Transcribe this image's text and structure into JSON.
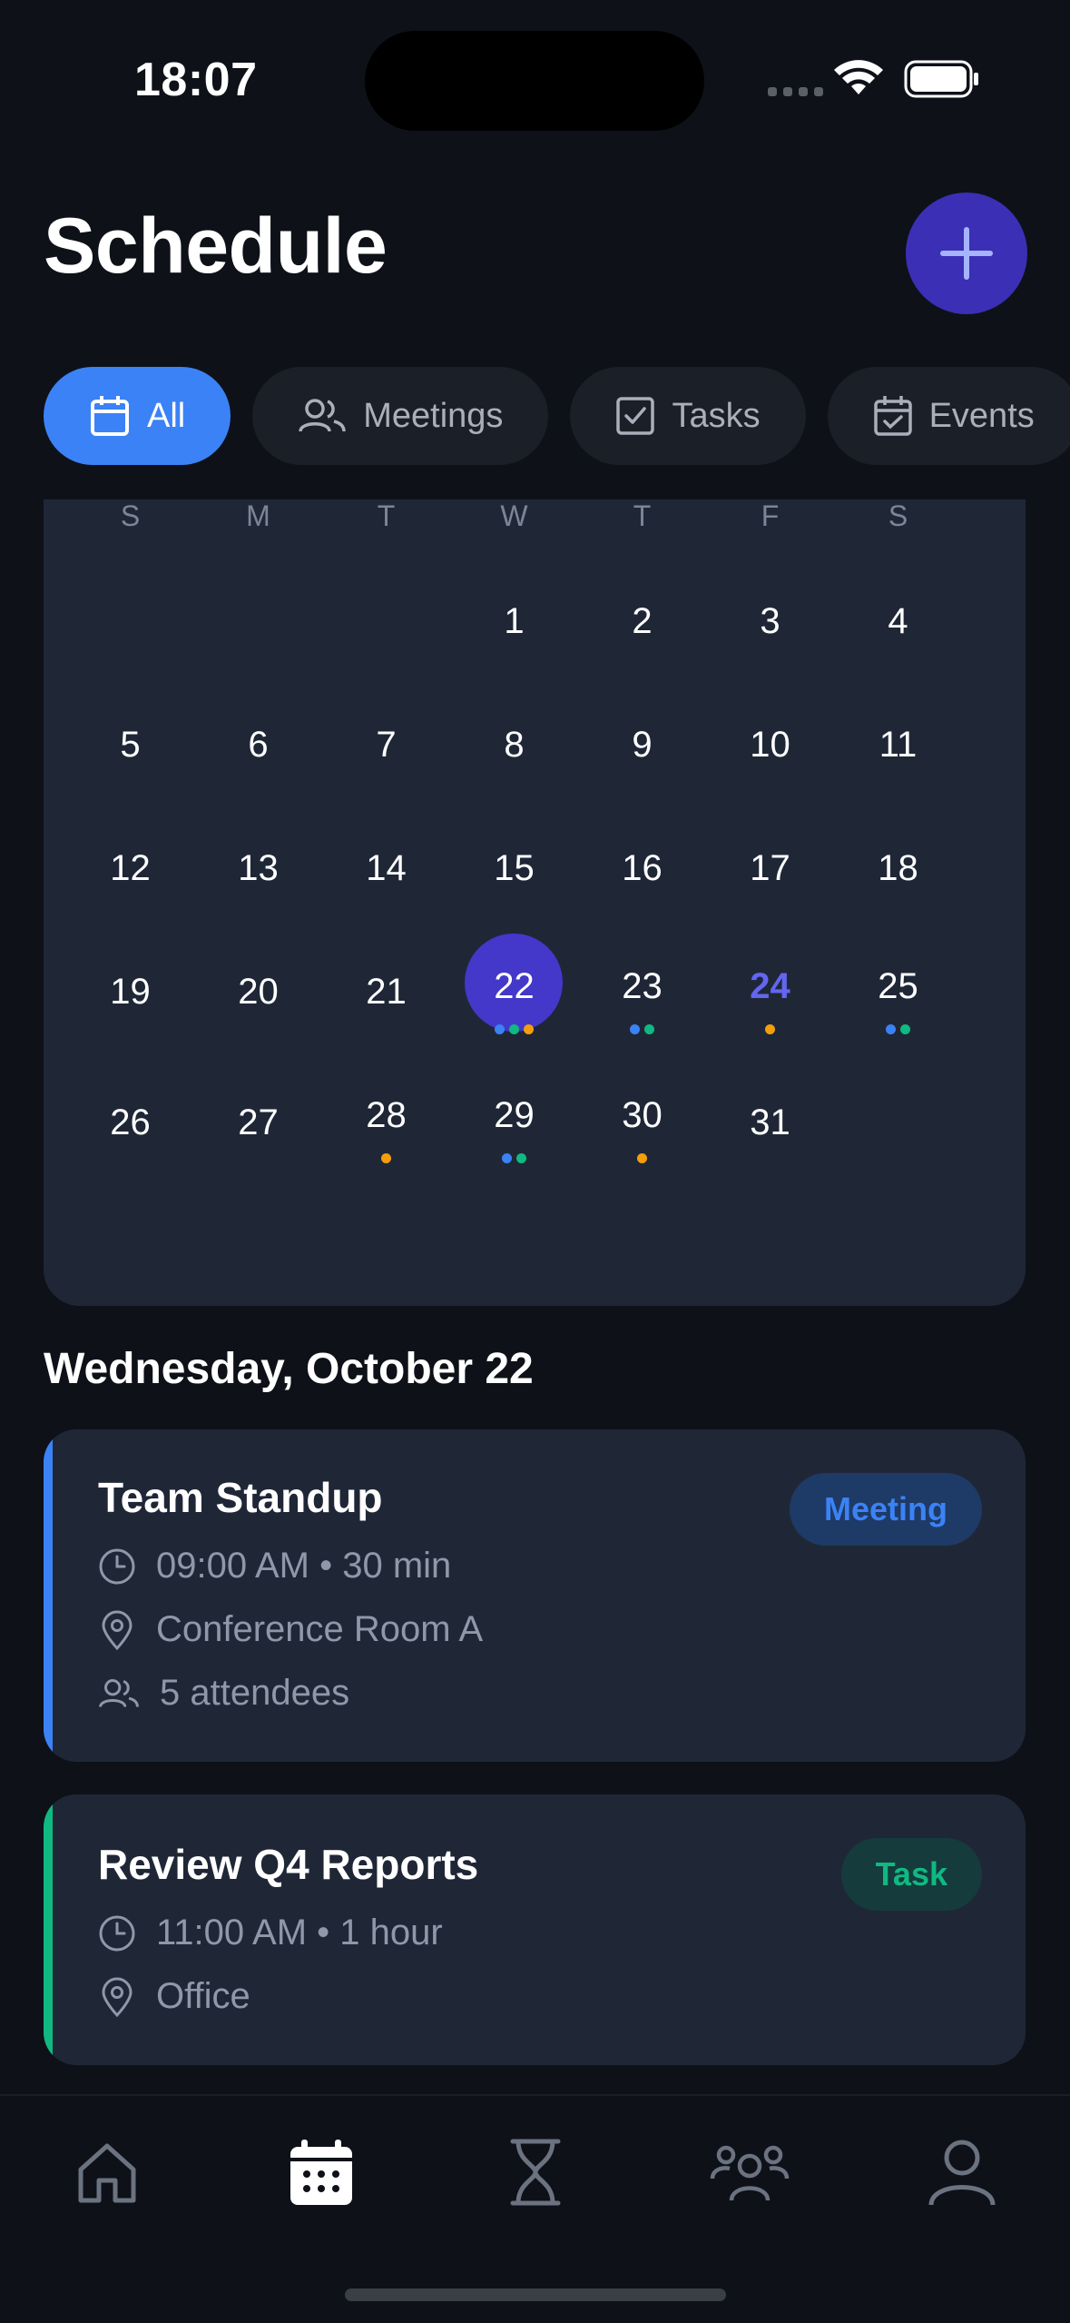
{
  "status_bar": {
    "time": "18:07"
  },
  "header": {
    "title": "Schedule",
    "add_label": "+"
  },
  "filters": [
    {
      "label": "All",
      "icon": "calendar-icon",
      "active": true
    },
    {
      "label": "Meetings",
      "icon": "people-icon",
      "active": false
    },
    {
      "label": "Tasks",
      "icon": "checkbox-icon",
      "active": false
    },
    {
      "label": "Events",
      "icon": "calendar-check-icon",
      "active": false
    }
  ],
  "calendar": {
    "weekdays": [
      "S",
      "M",
      "T",
      "W",
      "T",
      "F",
      "S"
    ],
    "selected_day": "22",
    "highlighted_day": "24",
    "rows": [
      [
        "",
        "",
        "",
        "1",
        "2",
        "3",
        "4"
      ],
      [
        "5",
        "6",
        "7",
        "8",
        "9",
        "10",
        "11"
      ],
      [
        "12",
        "13",
        "14",
        "15",
        "16",
        "17",
        "18"
      ],
      [
        "19",
        "20",
        "21",
        "22",
        "23",
        "24",
        "25"
      ],
      [
        "26",
        "27",
        "28",
        "29",
        "30",
        "31",
        ""
      ]
    ],
    "event_dots": {
      "22": [
        "blue",
        "green",
        "orange"
      ],
      "23": [
        "blue",
        "green"
      ],
      "24": [
        "orange"
      ],
      "25": [
        "blue",
        "green"
      ],
      "28": [
        "orange"
      ],
      "29": [
        "blue",
        "green"
      ],
      "30": [
        "orange"
      ]
    },
    "dot_colors": {
      "blue": "#3b82f6",
      "green": "#10b981",
      "orange": "#f59e0b"
    }
  },
  "day_section": {
    "heading": "Wednesday, October 22"
  },
  "events": [
    {
      "title": "Team Standup",
      "badge": "Meeting",
      "accent": "#3b82f6",
      "time": "09:00 AM • 30 min",
      "location": "Conference Room A",
      "attendees": "5 attendees"
    },
    {
      "title": "Review Q4 Reports",
      "badge": "Task",
      "accent": "#10b981",
      "time": "11:00 AM • 1 hour",
      "location": "Office"
    }
  ],
  "tabbar": [
    {
      "icon": "home-icon",
      "active": false
    },
    {
      "icon": "calendar-icon",
      "active": true
    },
    {
      "icon": "hourglass-icon",
      "active": false
    },
    {
      "icon": "group-icon",
      "active": false
    },
    {
      "icon": "profile-icon",
      "active": false
    }
  ]
}
